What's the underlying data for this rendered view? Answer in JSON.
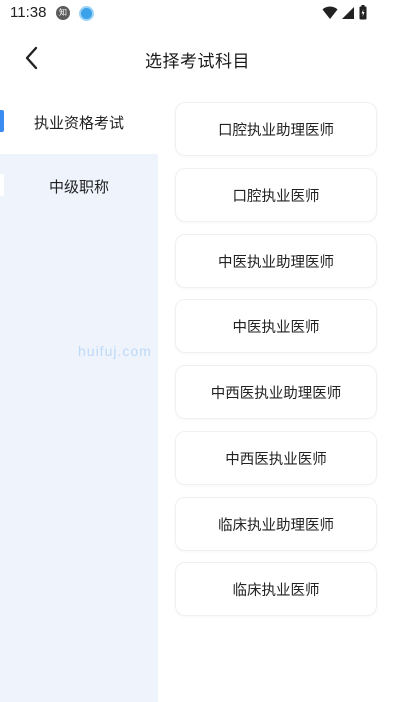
{
  "status_bar": {
    "time": "11:38",
    "notif_zhi": "知"
  },
  "header": {
    "title": "选择考试科目"
  },
  "sidebar": {
    "items": [
      {
        "label": "执业资格考试",
        "active": true
      },
      {
        "label": "中级职称",
        "active": false
      }
    ]
  },
  "watermark": "huifuj.com",
  "subjects": [
    {
      "label": "口腔执业助理医师"
    },
    {
      "label": "口腔执业医师"
    },
    {
      "label": "中医执业助理医师"
    },
    {
      "label": "中医执业医师"
    },
    {
      "label": "中西医执业助理医师"
    },
    {
      "label": "中西医执业医师"
    },
    {
      "label": "临床执业助理医师"
    },
    {
      "label": "临床执业医师"
    }
  ],
  "colors": {
    "accent": "#3b8cf2",
    "sidebar_bg": "#eef3fc",
    "card_border": "#eef0f3"
  },
  "icons": {
    "back": "chevron-left-icon",
    "wifi": "wifi-icon",
    "signal": "signal-icon",
    "battery": "battery-icon"
  }
}
